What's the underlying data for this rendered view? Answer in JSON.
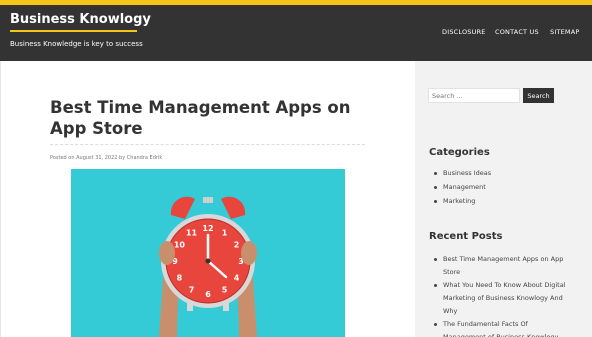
{
  "header": {
    "site_title": "Business Knowlogy",
    "tagline": "Business Knowledge is key to success",
    "nav": [
      "DISCLOSURE",
      "CONTACT US",
      "SITEMAP"
    ]
  },
  "post": {
    "title": "Best Time Management Apps on App Store",
    "meta": "Posted on August 31, 2022 by Chandra Edrik"
  },
  "sidebar": {
    "search": {
      "placeholder": "Search ...",
      "button": "Search"
    },
    "categories": {
      "title": "Categories",
      "items": [
        "Business Ideas",
        "Management",
        "Marketing"
      ]
    },
    "recent_posts": {
      "title": "Recent Posts",
      "items": [
        "Best Time Management Apps on App Store",
        "What You Need To Know About Digital Marketing of Business Knowlogy And Why",
        "The Fundamental Facts Of Management of Business Knowlogy"
      ]
    }
  },
  "clock_numbers": [
    "12",
    "1",
    "2",
    "3",
    "4",
    "5",
    "6",
    "7",
    "8",
    "9",
    "10",
    "11"
  ],
  "colors": {
    "accent": "#f5c518",
    "header_bg": "#333333",
    "image_bg": "#35cbd6",
    "clock_red": "#e8453c"
  }
}
